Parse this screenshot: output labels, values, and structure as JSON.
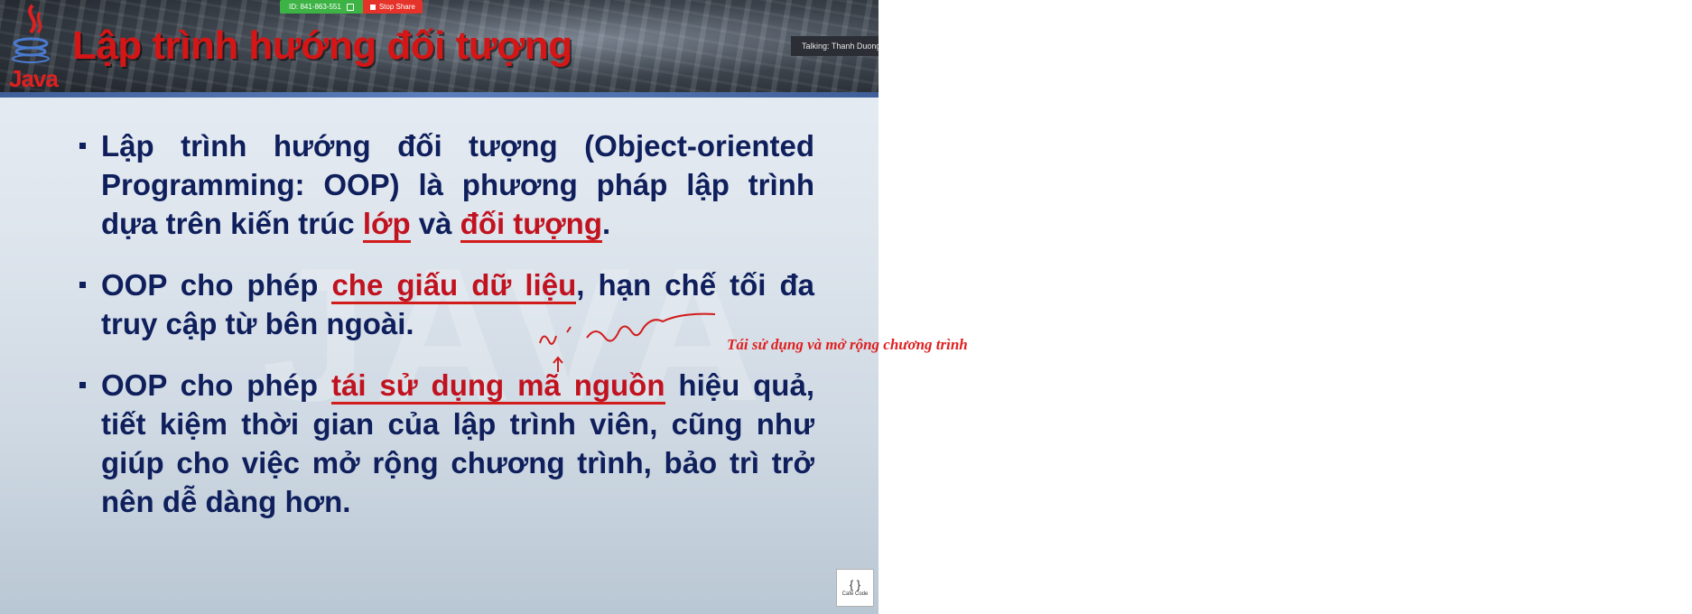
{
  "sharebar": {
    "meeting_id": "ID: 841-863-551",
    "stop_share_label": "Stop Share"
  },
  "talking": "Talking: Thanh Duong",
  "slide": {
    "logo_word": "Java",
    "title": "Lập trình hướng đối tượng",
    "watermark": "JAVA",
    "bullets": [
      {
        "parts": [
          {
            "text": "Lập trình hướng đối tượng (Object-oriented Programming: OOP) là phương pháp lập trình dựa trên kiến trúc ",
            "style": ""
          },
          {
            "text": "lớp",
            "style": "hl ul"
          },
          {
            "text": " và ",
            "style": ""
          },
          {
            "text": "đối tượng",
            "style": "hl ul"
          },
          {
            "text": ".",
            "style": ""
          }
        ]
      },
      {
        "parts": [
          {
            "text": "OOP cho phép ",
            "style": ""
          },
          {
            "text": "che giấu dữ liệu",
            "style": "hl ul"
          },
          {
            "text": ", hạn chế tối đa truy cập từ bên ngoài.",
            "style": ""
          }
        ]
      },
      {
        "parts": [
          {
            "text": "OOP cho phép ",
            "style": ""
          },
          {
            "text": "tái sử dụng mã nguồn",
            "style": "hl ul"
          },
          {
            "text": " hiệu quả, tiết kiệm thời gian của lập trình viên, cũng như giúp cho việc mở rộng chương trình, bảo trì trở nên dễ dàng hơn.",
            "style": ""
          }
        ]
      }
    ],
    "handwriting_note": "mở rộng",
    "brand_logo_text": "Cafe Code"
  },
  "caption": "Tái sử dụng và mở rộng chương trình",
  "colors": {
    "title_red": "#d41616",
    "body_navy": "#0f1f5c",
    "ink_red": "#d21b1b",
    "share_green": "#3db345",
    "stop_red": "#e5332a"
  }
}
